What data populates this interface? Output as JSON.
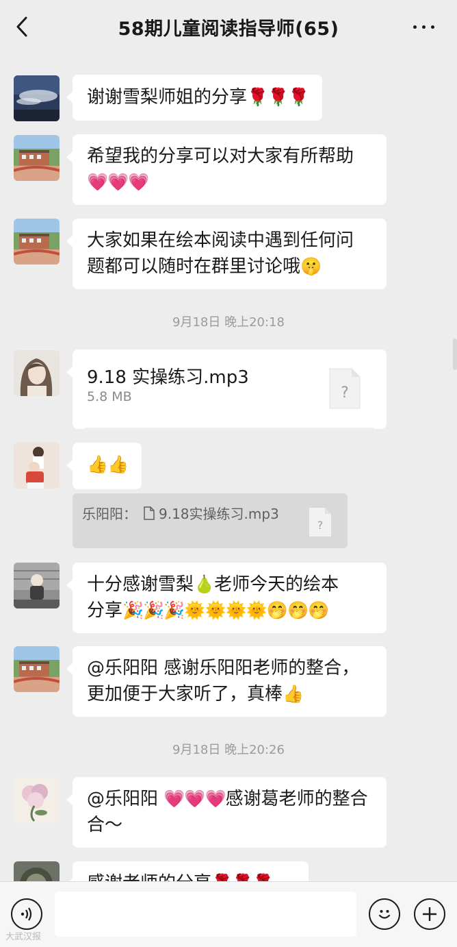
{
  "header": {
    "title": "58期儿童阅读指导师(65)"
  },
  "messages": [
    {
      "text": "谢谢雪梨师姐的分享",
      "emoji": "🌹🌹🌹"
    },
    {
      "line1": "希望我的分享可以对大家有所帮助",
      "line2_emoji": "💗💗💗"
    },
    {
      "line1": "大家如果在绘本阅读中遇到任何问",
      "line2": "题都可以随时在群里讨论哦",
      "line2_emoji": "🤫"
    },
    {
      "filename": "9.18 实操练习.mp3",
      "filesize": "5.8 MB"
    },
    {
      "emoji": "👍👍"
    },
    {
      "quote_sender": "乐阳阳：",
      "quote_file": "9.18实操练习.mp3"
    },
    {
      "line1": "十分感谢雪梨",
      "line1_emoji": "🍐",
      "line1b": "老师今天的绘本",
      "line2": "分享",
      "line2_emoji": "🎉🎉🎉🌞🌞🌞🌞🤭🤭🤭"
    },
    {
      "line1": "@乐阳阳  感谢乐阳阳老师的整合，",
      "line2": "更加便于大家听了，真棒",
      "line2_emoji": "👍"
    },
    {
      "line1a": "@乐阳阳 ",
      "line1_emoji": "💗💗💗",
      "line1b": "感谢葛老师的整合",
      "line2": "合～"
    },
    {
      "text": "感谢老师的分享",
      "emoji": "🌹🌹🌹"
    }
  ],
  "timestamps": [
    "9月18日 晚上20:18",
    "9月18日 晚上20:26"
  ],
  "file_icon_glyph": "?",
  "footer": {
    "voice_icon": "voice-icon",
    "emoji_icon": "smiley-icon",
    "plus_icon": "plus-icon"
  },
  "watermark": "大武汉报"
}
